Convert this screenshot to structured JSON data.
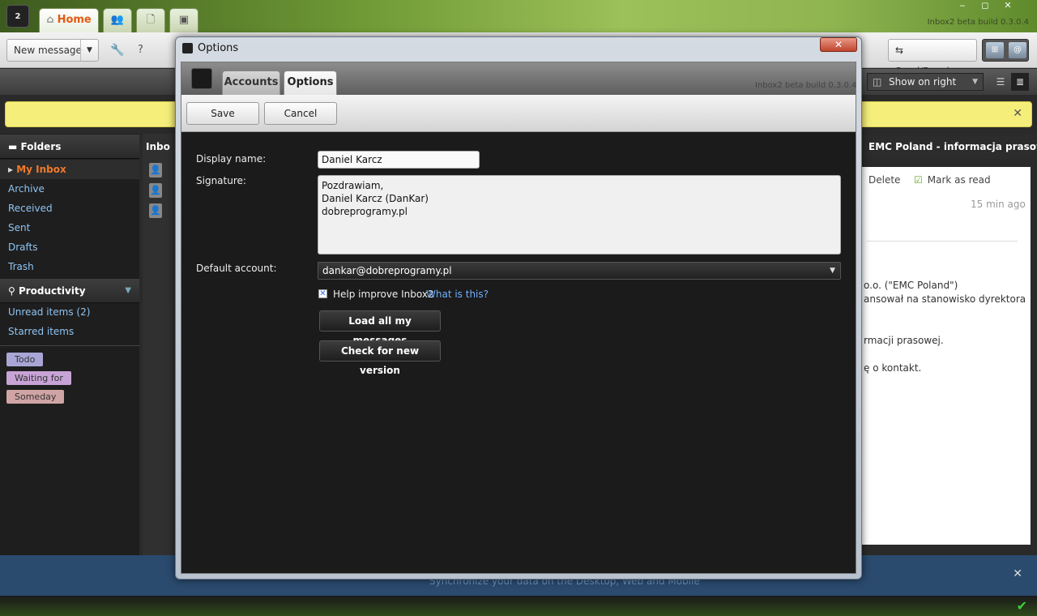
{
  "app": {
    "tabs": {
      "home": "Home"
    },
    "build": "Inbox2 beta build 0.3.0.4",
    "window_controls": {
      "minimize": "‒",
      "maximize": "◻",
      "close": "✕"
    }
  },
  "toolbar": {
    "new_message": "New message",
    "send_receive": "Send/Receive",
    "help": "?",
    "show_on_right": "Show on right"
  },
  "sidebar": {
    "folders_title": "Folders",
    "folders": [
      "My Inbox",
      "Archive",
      "Received",
      "Sent",
      "Drafts",
      "Trash"
    ],
    "productivity_title": "Productivity",
    "productivity": [
      "Unread items  (2)",
      "Starred items"
    ],
    "tags": [
      "Todo",
      "Waiting for",
      "Someday"
    ]
  },
  "list": {
    "header": "Inbo"
  },
  "reading": {
    "header": "EMC Poland - informacja prasowa",
    "delete": "Delete",
    "mark_as_read": "Mark as read",
    "time": "15 min ago",
    "body": [
      "o.o. (\"EMC Poland\")",
      "ansował na stanowisko dyrektora",
      "rmacji prasowej.",
      "ę o kontakt."
    ]
  },
  "bottom": {
    "text": "Synchronize your data on the Desktop, Web and Mobile"
  },
  "dialog": {
    "title": "Options",
    "tabs": {
      "accounts": "Accounts",
      "options": "Options"
    },
    "build": "Inbox2 beta build 0.3.0.4",
    "buttons": {
      "save": "Save",
      "cancel": "Cancel"
    },
    "labels": {
      "display_name": "Display name:",
      "signature": "Signature:",
      "default_account": "Default account:"
    },
    "display_name": "Daniel Karcz",
    "signature": "Pozdrawiam,\nDaniel Karcz (DanKar)\ndobreprogramy.pl",
    "default_account": "dankar@dobreprogramy.pl",
    "help_improve": "Help improve Inbox2",
    "what_is_this": "What is this?",
    "load_all": "Load all my messages",
    "check_version": "Check for new version",
    "close": "✕"
  },
  "colors": {
    "accent_orange": "#e35a12",
    "link_blue": "#6fb1ff",
    "notice_yellow": "#f6ee7a"
  }
}
